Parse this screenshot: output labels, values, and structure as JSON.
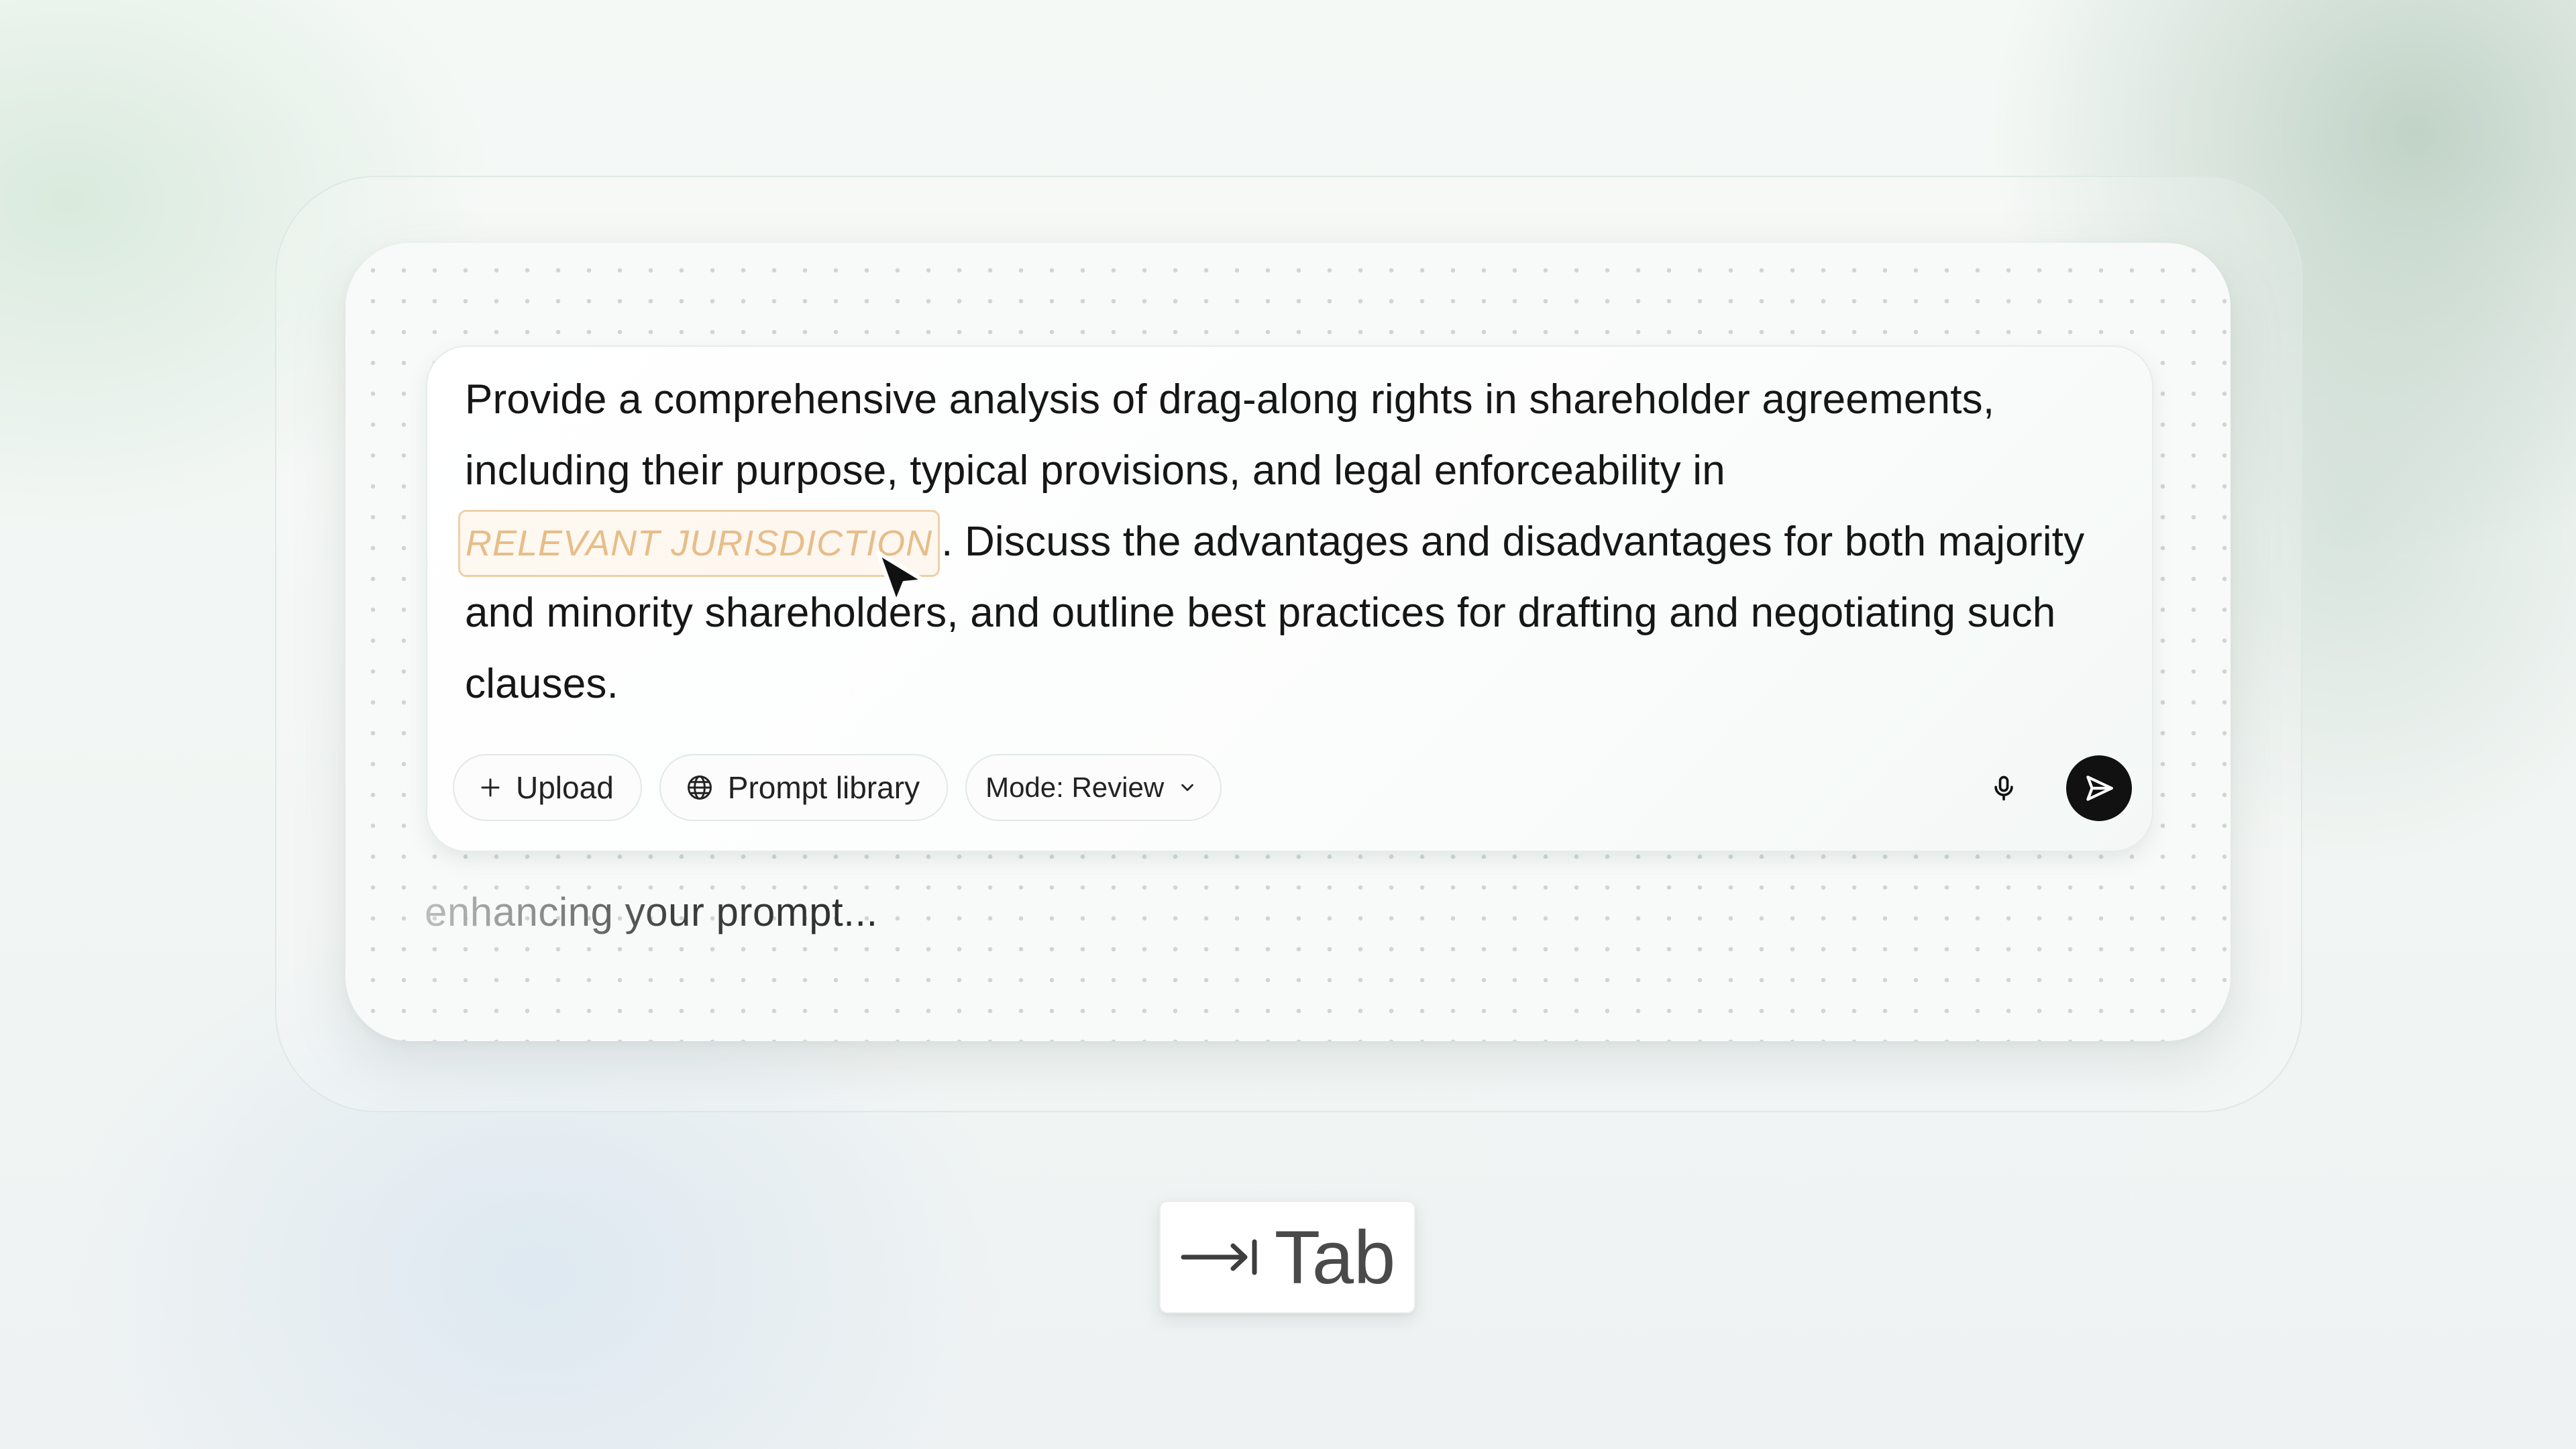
{
  "prompt": {
    "text_before": "Provide a comprehensive analysis of drag-along rights in shareholder agreements, including their purpose, typical provisions, and legal enforceability in ",
    "placeholder": "RELEVANT JURISDICTION",
    "text_after": ". Discuss the  advantages and disadvantages for both majority and minority shareholders, and outline best practices for drafting and negotiating such clauses."
  },
  "toolbar": {
    "upload_label": "Upload",
    "upload_icon": "plus-icon",
    "library_label": "Prompt library",
    "library_icon": "globe-icon",
    "mode_label": "Mode: Review",
    "mode_icon": "chevron-down-icon",
    "mic_icon": "microphone-icon",
    "send_icon": "send-icon"
  },
  "status": {
    "text": "enhancing your prompt..."
  },
  "keyhint": {
    "icon": "tab-arrow-icon",
    "label": "Tab"
  },
  "colors": {
    "placeholder_border": "#f0cfa6",
    "placeholder_text": "#e7bd88",
    "send_button": "#111111"
  }
}
